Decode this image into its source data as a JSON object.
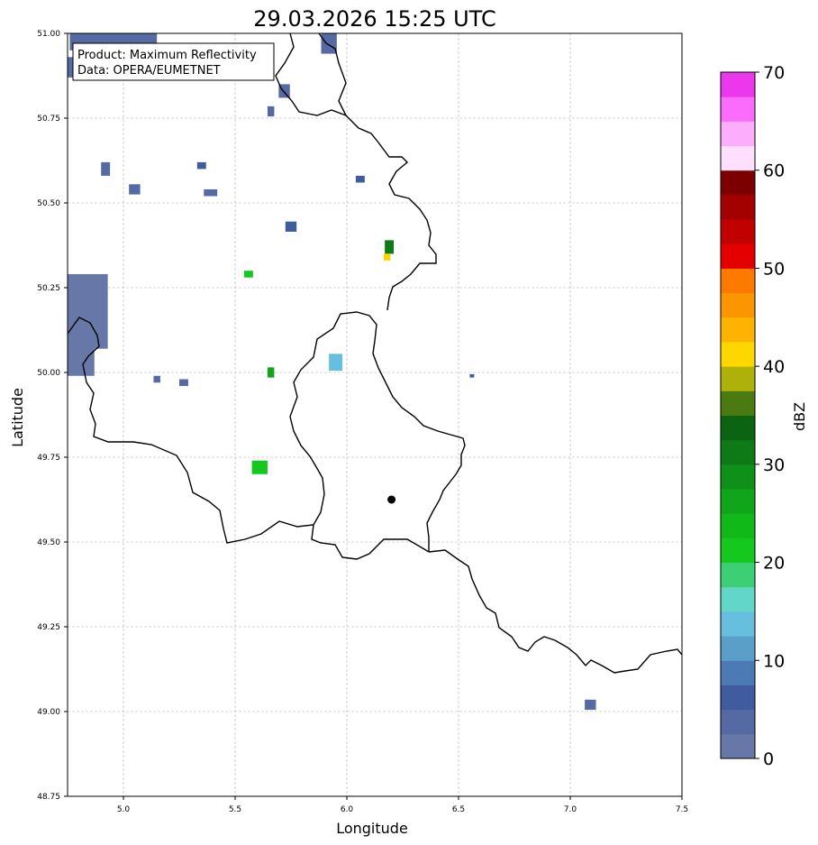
{
  "title": "29.03.2026 15:25 UTC",
  "info_box": {
    "line1": "Product: Maximum Reflectivity",
    "line2": "Data: OPERA/EUMETNET"
  },
  "axes": {
    "xlabel": "Longitude",
    "ylabel": "Latitude",
    "xlim": [
      4.75,
      7.5
    ],
    "ylim": [
      48.75,
      51.0
    ],
    "xticks": [
      "5.0",
      "5.5",
      "6.0",
      "6.5",
      "7.0",
      "7.5"
    ],
    "yticks": [
      "48.75",
      "49.00",
      "49.25",
      "49.50",
      "49.75",
      "50.00",
      "50.25",
      "50.50",
      "50.75",
      "51.00"
    ],
    "grid": true
  },
  "colorbar": {
    "label": "dBZ",
    "min": 0,
    "max": 70,
    "ticks": [
      "0",
      "10",
      "20",
      "30",
      "40",
      "50",
      "60",
      "70"
    ],
    "colors": [
      "#6677a8",
      "#5569a2",
      "#415b9f",
      "#4b7ab5",
      "#5a9fc8",
      "#67bfdf",
      "#62d6c8",
      "#3dcf73",
      "#14c81e",
      "#10b918",
      "#11a51b",
      "#0f9119",
      "#0d7a16",
      "#0a6411",
      "#4a7a10",
      "#adb10a",
      "#fed700",
      "#fcb400",
      "#fc9600",
      "#fc7a00",
      "#e50000",
      "#c10000",
      "#a30000",
      "#7c0000",
      "#fee0fe",
      "#fcaefc",
      "#fc6cfc",
      "#ec38ec"
    ]
  },
  "marker": {
    "lon": 6.2,
    "lat": 49.625
  },
  "chart_data": {
    "type": "heatmap",
    "title": "29.03.2026 15:25 UTC",
    "xlabel": "Longitude",
    "ylabel": "Latitude",
    "xlim": [
      4.75,
      7.5
    ],
    "ylim": [
      48.75,
      51.0
    ],
    "value_label": "dBZ",
    "value_range": [
      0,
      70
    ],
    "echoes": [
      {
        "lon": 4.87,
        "lat": 50.98,
        "w": 0.22,
        "h": 0.05,
        "dbz": 3
      },
      {
        "lon": 4.78,
        "lat": 50.9,
        "w": 0.08,
        "h": 0.06,
        "dbz": 3
      },
      {
        "lon": 5.05,
        "lat": 50.99,
        "w": 0.2,
        "h": 0.03,
        "dbz": 4
      },
      {
        "lon": 5.92,
        "lat": 50.98,
        "w": 0.07,
        "h": 0.06,
        "dbz": 3
      },
      {
        "lon": 5.72,
        "lat": 50.83,
        "w": 0.05,
        "h": 0.04,
        "dbz": 3
      },
      {
        "lon": 5.66,
        "lat": 50.77,
        "w": 0.03,
        "h": 0.03,
        "dbz": 3
      },
      {
        "lon": 5.05,
        "lat": 50.54,
        "w": 0.05,
        "h": 0.03,
        "dbz": 4
      },
      {
        "lon": 4.92,
        "lat": 50.6,
        "w": 0.04,
        "h": 0.04,
        "dbz": 4
      },
      {
        "lon": 5.35,
        "lat": 50.61,
        "w": 0.04,
        "h": 0.02,
        "dbz": 5
      },
      {
        "lon": 5.39,
        "lat": 50.53,
        "w": 0.06,
        "h": 0.02,
        "dbz": 4
      },
      {
        "lon": 6.06,
        "lat": 50.57,
        "w": 0.04,
        "h": 0.02,
        "dbz": 5
      },
      {
        "lon": 5.75,
        "lat": 50.43,
        "w": 0.05,
        "h": 0.03,
        "dbz": 6
      },
      {
        "lon": 4.84,
        "lat": 50.18,
        "w": 0.18,
        "h": 0.22,
        "dbz": 2
      },
      {
        "lon": 4.8,
        "lat": 50.06,
        "w": 0.12,
        "h": 0.14,
        "dbz": 2
      },
      {
        "lon": 5.27,
        "lat": 49.97,
        "w": 0.04,
        "h": 0.02,
        "dbz": 4
      },
      {
        "lon": 5.15,
        "lat": 49.98,
        "w": 0.03,
        "h": 0.02,
        "dbz": 4
      },
      {
        "lon": 5.56,
        "lat": 50.29,
        "w": 0.04,
        "h": 0.02,
        "dbz": 22
      },
      {
        "lon": 5.66,
        "lat": 50.0,
        "w": 0.03,
        "h": 0.03,
        "dbz": 25
      },
      {
        "lon": 5.95,
        "lat": 50.03,
        "w": 0.06,
        "h": 0.05,
        "dbz": 14
      },
      {
        "lon": 6.19,
        "lat": 50.37,
        "w": 0.04,
        "h": 0.04,
        "dbz": 30
      },
      {
        "lon": 6.18,
        "lat": 50.34,
        "w": 0.03,
        "h": 0.02,
        "dbz": 42
      },
      {
        "lon": 5.61,
        "lat": 49.72,
        "w": 0.07,
        "h": 0.04,
        "dbz": 20
      },
      {
        "lon": 7.09,
        "lat": 49.02,
        "w": 0.05,
        "h": 0.03,
        "dbz": 3
      },
      {
        "lon": 6.56,
        "lat": 49.99,
        "w": 0.02,
        "h": 0.01,
        "dbz": 5
      }
    ]
  }
}
